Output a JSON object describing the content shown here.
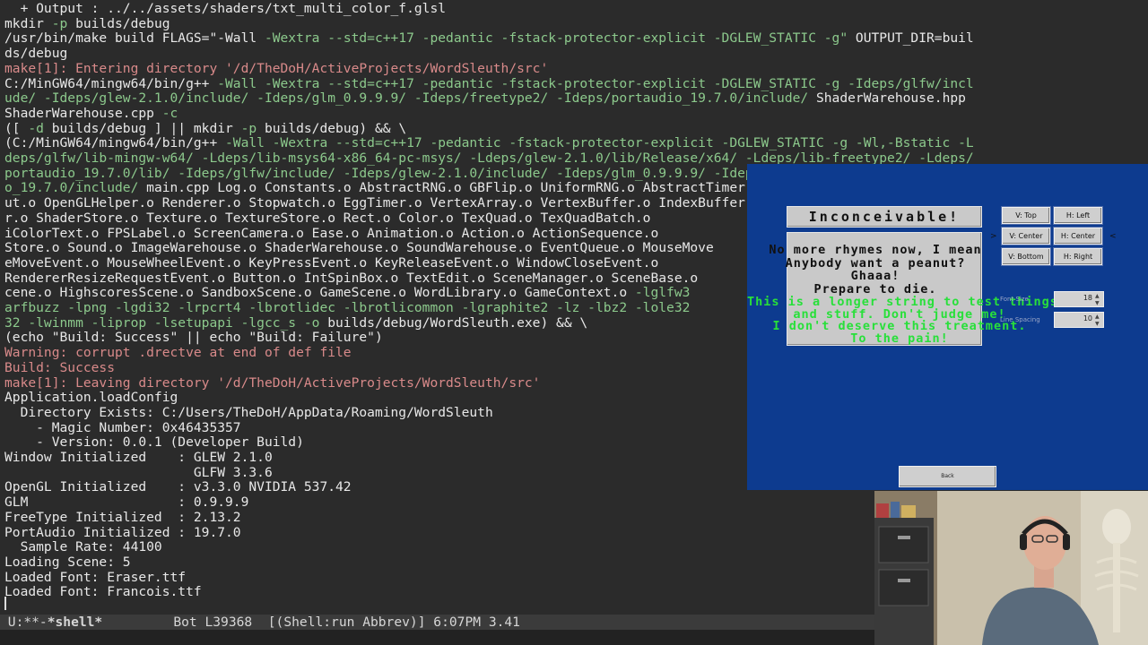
{
  "terminal": {
    "lines": [
      [
        [
          "w",
          "  + Output : ../../assets/shaders/txt_multi_color_f.glsl"
        ]
      ],
      [
        [
          "w",
          "mkdir "
        ],
        [
          "g",
          "-p"
        ],
        [
          "w",
          " builds/debug"
        ]
      ],
      [
        [
          "w",
          "/usr/bin/make build FLAGS=\"-Wall "
        ],
        [
          "g",
          "-Wextra --std=c++17 -pedantic -fstack-protector-explicit -DGLEW_STATIC -g\""
        ],
        [
          "w",
          " OUTPUT_DIR=buil"
        ]
      ],
      [
        [
          "w",
          "ds/debug"
        ]
      ],
      [
        [
          "r",
          "make[1]: Entering directory '/d/TheDoH/ActiveProjects/WordSleuth/src'"
        ]
      ],
      [
        [
          "w",
          "C:/MinGW64/mingw64/bin/g++ "
        ],
        [
          "g",
          "-Wall -Wextra --std=c++17 -pedantic -fstack-protector-explicit -DGLEW_STATIC -g -Ideps/glfw/incl"
        ]
      ],
      [
        [
          "g",
          "ude/ -Ideps/glew-2.1.0/include/ -Ideps/glm_0.9.9.9/ -Ideps/freetype2/ -Ideps/portaudio_19.7.0/include/"
        ],
        [
          "w",
          " ShaderWarehouse.hpp"
        ]
      ],
      [
        [
          "w",
          "ShaderWarehouse.cpp "
        ],
        [
          "g",
          "-c"
        ]
      ],
      [
        [
          "w",
          "([ "
        ],
        [
          "g",
          "-d"
        ],
        [
          "w",
          " builds/debug ] || mkdir "
        ],
        [
          "g",
          "-p"
        ],
        [
          "w",
          " builds/debug) && \\"
        ]
      ],
      [
        [
          "w",
          "(C:/MinGW64/mingw64/bin/g++ "
        ],
        [
          "g",
          "-Wall -Wextra --std=c++17 -pedantic -fstack-protector-explicit -DGLEW_STATIC -g -Wl,-Bstatic -L"
        ]
      ],
      [
        [
          "g",
          "deps/glfw/lib-mingw-w64/ -Ldeps/lib-msys64-x86_64-pc-msys/ -Ldeps/glew-2.1.0/lib/Release/x64/ -Ldeps/lib-freetype2/ -Ldeps/"
        ]
      ],
      [
        [
          "g",
          "portaudio_19.7.0/lib/ -Ideps/glfw/include/ -Ideps/glew-2.1.0/include/ -Ideps/glm_0.9.9.9/ -Ideps/freetype2/ -Ideps/portaudi"
        ]
      ],
      [
        [
          "g",
          "o_19.7.0/include/"
        ],
        [
          "w",
          " main.cpp Log.o Constants.o AbstractRNG.o GBFlip.o UniformRNG.o AbstractTimer.o"
        ]
      ],
      [
        [
          "w",
          "ut.o OpenGLHelper.o Renderer.o Stopwatch.o EggTimer.o VertexArray.o VertexBuffer.o IndexBuffer.o"
        ]
      ],
      [
        [
          "w",
          "r.o ShaderStore.o Texture.o TextureStore.o Rect.o Color.o TexQuad.o TexQuadBatch.o"
        ]
      ],
      [
        [
          "w",
          "iColorText.o FPSLabel.o ScreenCamera.o Ease.o Animation.o Action.o ActionSequence.o"
        ]
      ],
      [
        [
          "w",
          "Store.o Sound.o ImageWarehouse.o ShaderWarehouse.o SoundWarehouse.o EventQueue.o MouseMove"
        ]
      ],
      [
        [
          "w",
          "eMoveEvent.o MouseWheelEvent.o KeyPressEvent.o KeyReleaseEvent.o WindowCloseEvent.o"
        ]
      ],
      [
        [
          "w",
          "RendererResizeRequestEvent.o Button.o IntSpinBox.o TextEdit.o SceneManager.o SceneBase.o"
        ]
      ],
      [
        [
          "w",
          "cene.o HighscoresScene.o SandboxScene.o GameScene.o WordLibrary.o GameContext.o "
        ],
        [
          "g",
          "-lglfw3"
        ]
      ],
      [
        [
          "g",
          "arfbuzz -lpng -lgdi32 -lrpcrt4 -lbrotlidec -lbrotlicommon -lgraphite2 -lz -lbz2 -lole32"
        ]
      ],
      [
        [
          "g",
          "32 -lwinmm -liprop -lsetupapi -lgcc_s -o"
        ],
        [
          "w",
          " builds/debug/WordSleuth.exe) && \\"
        ]
      ],
      [
        [
          "w",
          "(echo \"Build: Success\" || echo \"Build: Failure\")"
        ]
      ],
      [
        [
          "r",
          "Warning: corrupt .drectve at end of def file"
        ]
      ],
      [
        [
          "r",
          "Build: Success"
        ]
      ],
      [
        [
          "r",
          "make[1]: Leaving directory '/d/TheDoH/ActiveProjects/WordSleuth/src'"
        ]
      ],
      [
        [
          "w",
          "Application.loadConfig"
        ]
      ],
      [
        [
          "w",
          "  Directory Exists: C:/Users/TheDoH/AppData/Roaming/WordSleuth"
        ]
      ],
      [
        [
          "w",
          "    - Magic Number: 0x46435357"
        ]
      ],
      [
        [
          "w",
          "    - Version: 0.0.1 (Developer Build)"
        ]
      ],
      [
        [
          "w",
          "Window Initialized    : GLEW 2.1.0"
        ]
      ],
      [
        [
          "w",
          "                        GLFW 3.3.6"
        ]
      ],
      [
        [
          "w",
          "OpenGL Initialized    : v3.3.0 NVIDIA 537.42"
        ]
      ],
      [
        [
          "w",
          "GLM                   : 0.9.9.9"
        ]
      ],
      [
        [
          "w",
          "FreeType Initialized  : 2.13.2"
        ]
      ],
      [
        [
          "w",
          "PortAudio Initialized : 19.7.0"
        ]
      ],
      [
        [
          "w",
          "  Sample Rate: 44100"
        ]
      ],
      [
        [
          "w",
          "Loading Scene: 5"
        ]
      ],
      [
        [
          "w",
          "Loaded Font: Eraser.ttf"
        ]
      ],
      [
        [
          "w",
          "Loaded Font: Francois.ttf"
        ]
      ]
    ]
  },
  "modeline": {
    "status": " U:**-",
    "buffer": "*shell*",
    "position": "Bot L39368",
    "mode": "[(Shell:run Abbrev)]",
    "time": "6:07PM",
    "load": "3.41"
  },
  "game": {
    "title": "Inconceivable!",
    "sample_black": "No more rhymes now, I mean\nAnybody want a peanut?\nGhaaa!\nPrepare to die.",
    "sample_green": "This is a longer string to test things\nand stuff. Don't judge me!\nI don't deserve this treatment.\nTo the pain!",
    "buttons": {
      "v_top": "V: Top",
      "h_left": "H: Left",
      "v_center": "V: Center",
      "h_center": "H: Center",
      "v_bottom": "V: Bottom",
      "h_right": "H: Right",
      "back": "Back"
    },
    "markers": {
      "left": ">",
      "right": "<"
    },
    "font_size": {
      "label": "Font Size",
      "value": "18"
    },
    "line_spacing": {
      "label": "Line Spacing",
      "value": "10"
    }
  },
  "colors": {
    "terminal_bg": "#2b2b2b",
    "flag_green": "#8cc98c",
    "make_red": "#d98a8a",
    "game_bg": "#0d3b8f",
    "sample_green": "#28e03a"
  }
}
